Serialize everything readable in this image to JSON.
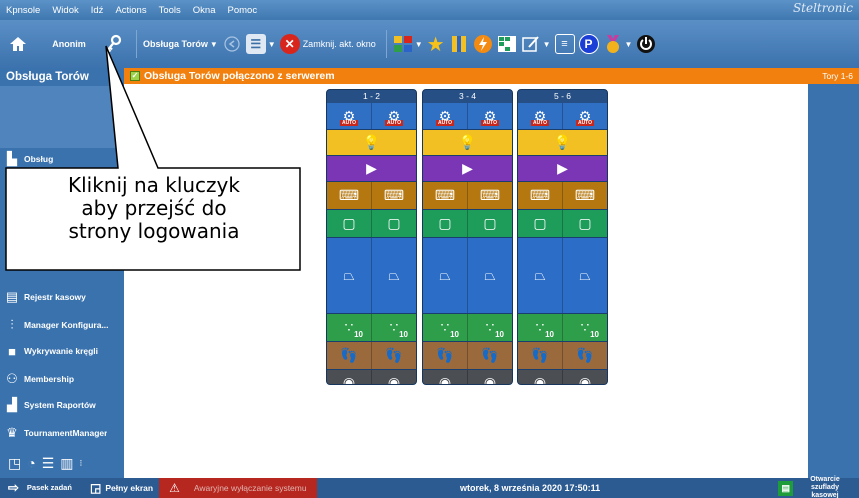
{
  "menu": {
    "items": [
      "Kpnsole",
      "Widok",
      "Idź",
      "Actions",
      "Tools",
      "Okna",
      "Pomoc"
    ],
    "brand": "Steltronic"
  },
  "toolbar": {
    "user_label": "Anonim",
    "lanes_label": "Obsługa Torów",
    "close_label": "Zamknij. akt. okno",
    "p_label": "P"
  },
  "sidebar": {
    "title": "Obsługa Torów",
    "items": [
      {
        "label": "Obsług",
        "icon": "lane-icon"
      },
      {
        "label": "Rejestr kasowy",
        "icon": "cash-register-icon"
      },
      {
        "label": "Manager Konfigura...",
        "icon": "sliders-icon"
      },
      {
        "label": "Wykrywanie kręgli",
        "icon": "camera-icon"
      },
      {
        "label": "Membership",
        "icon": "members-icon"
      },
      {
        "label": "System Raportów",
        "icon": "reports-icon"
      },
      {
        "label": "TournamentManager",
        "icon": "trophy-icon"
      }
    ]
  },
  "status_bar": {
    "text": "Obsługa Torów połączono z serwerem",
    "right": "Tory 1-6"
  },
  "lanes": [
    {
      "header": "1 - 2",
      "ten": "10"
    },
    {
      "header": "3 - 4",
      "ten": "10"
    },
    {
      "header": "5 - 6",
      "ten": "10"
    }
  ],
  "auto_tag": "AUTO",
  "callout": {
    "lines": [
      "Kliknij na kluczyk",
      "aby przejść do",
      "strony logowania"
    ]
  },
  "taskbar": {
    "pasek": "Pasek zadań",
    "fullscreen": "Pełny ekran",
    "emergency": "Awaryjne wyłączanie systemu",
    "datetime": "wtorek, 8 września 2020 17:50:11",
    "drawer": "Otwarcie szuflady kasowej"
  },
  "colors": {
    "accent": "#3a72ae",
    "orange": "#f2800f",
    "red": "#b5271f"
  }
}
